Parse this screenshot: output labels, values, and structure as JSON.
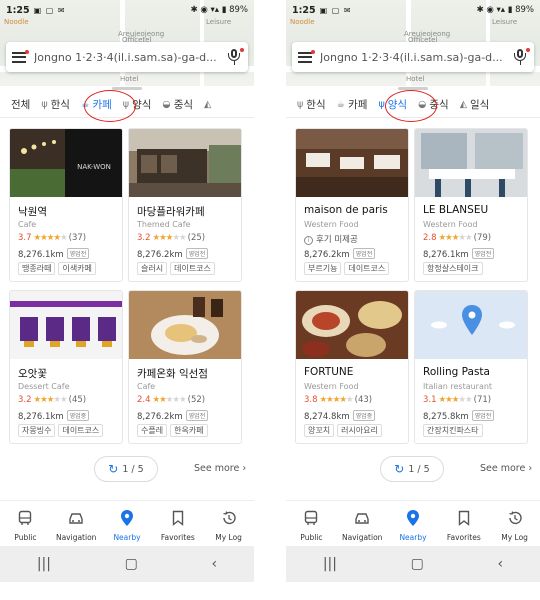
{
  "status": {
    "time": "1:25",
    "battery": "89%"
  },
  "map": {
    "pois": [
      "Noodle",
      "Areujeojeong",
      "Officetel",
      "Hotel",
      "Leisure"
    ]
  },
  "tabs_left": [
    "전체",
    "한식",
    "카페",
    "양식",
    "중식"
  ],
  "tabs_right": [
    "한식",
    "카페",
    "양식",
    "중식",
    "일식"
  ],
  "left": {
    "search": "Jongno 1·2·3·4(il.i.sam.sa)-ga-d...",
    "cards": [
      {
        "name": "낙원역",
        "category": "Cafe",
        "rating": "3.7",
        "reviews": "(37)",
        "distance": "8,276.1km",
        "open": "영업전",
        "tags": [
          "땡종라떼",
          "이색카페"
        ],
        "thumb_text": "NAK-WON"
      },
      {
        "name": "마당플라워카페",
        "category": "Themed Cafe",
        "rating": "3.2",
        "reviews": "(25)",
        "distance": "8,276.2km",
        "open": "영업전",
        "tags": [
          "슬러시",
          "데이트코스"
        ]
      },
      {
        "name": "오앗꽃",
        "category": "Dessert Cafe",
        "rating": "3.2",
        "reviews": "(45)",
        "distance": "8,276.1km",
        "open": "영업중",
        "tags": [
          "자몽빙수",
          "데이트코스"
        ]
      },
      {
        "name": "카페온화 익선점",
        "category": "Cafe",
        "rating": "2.4",
        "reviews": "(52)",
        "distance": "8,276.2km",
        "open": "영업전",
        "tags": [
          "수플레",
          "한옥카페"
        ]
      }
    ],
    "pager": "1 / 5",
    "see_more": "See more"
  },
  "right": {
    "search": "Jongno 1·2·3·4(il.i.sam.sa)-ga-d...",
    "cards": [
      {
        "name": "maison de paris",
        "category": "Western Food",
        "feature": "후기 미제공",
        "distance": "8,276.2km",
        "open": "영업전",
        "tags": [
          "부르기뇽",
          "데이트코스"
        ]
      },
      {
        "name": "LE BLANSEU",
        "category": "Western Food",
        "rating": "2.8",
        "reviews": "(79)",
        "distance": "8,276.1km",
        "open": "영업전",
        "tags": [
          "항정살스테이크"
        ]
      },
      {
        "name": "FORTUNE",
        "category": "Western Food",
        "rating": "3.8",
        "reviews": "(43)",
        "distance": "8,274.8km",
        "open": "영업중",
        "tags": [
          "양꼬치",
          "러시아요리"
        ]
      },
      {
        "name": "Rolling Pasta",
        "category": "Italian restaurant",
        "rating": "3.1",
        "reviews": "(71)",
        "distance": "8,275.8km",
        "open": "영업전",
        "tags": [
          "간장치킨파스타"
        ]
      }
    ],
    "pager": "1 / 5",
    "see_more": "See more"
  },
  "nav": [
    "Public",
    "Navigation",
    "Nearby",
    "Favorites",
    "My Log"
  ],
  "colors": {
    "accent": "#1a73e8",
    "rating": "#e8502e",
    "star": "#f2a42b",
    "highlight_circle": "#e0231c"
  },
  "icons": {
    "tabs": [
      "spoon-fork-icon",
      "cup-icon",
      "bowl-icon"
    ],
    "nav": [
      "bus-icon",
      "car-icon",
      "pin-icon",
      "bookmark-icon",
      "history-icon"
    ]
  }
}
